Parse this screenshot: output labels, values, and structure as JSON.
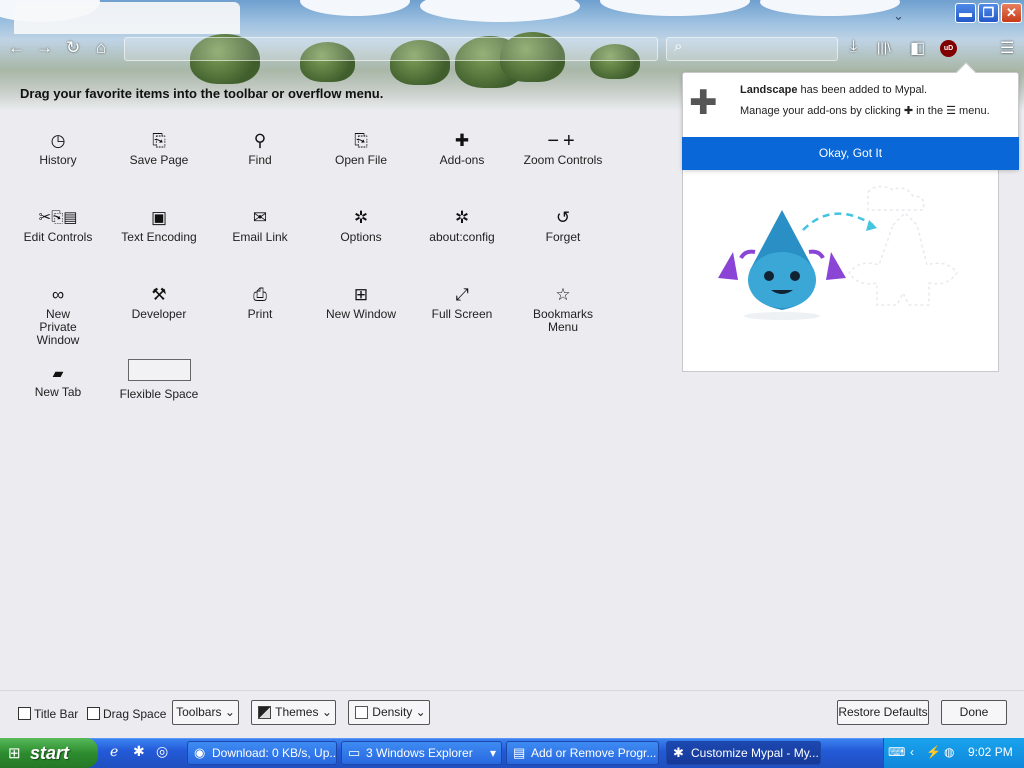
{
  "colors": {
    "accent": "#0a67d8",
    "taskbar": "#245ad8",
    "start": "#2d8c2f"
  },
  "window_buttons": {
    "minimize": "▬",
    "restore": "❐",
    "close": "✕"
  },
  "nav": {
    "back": "←",
    "forward": "→",
    "reload": "↻",
    "home": "⌂",
    "search_glyph": "⌕",
    "downloads": "⤓",
    "library": "|||\\",
    "sidebar": "◧",
    "ublock": "uD",
    "menu": "☰",
    "tab_list": "⌄"
  },
  "drag_hint": "Drag your favorite items into the toolbar or overflow menu.",
  "palette": [
    {
      "name": "history",
      "icon": "◷",
      "label": "History"
    },
    {
      "name": "save-page",
      "icon": "⎘",
      "label": "Save Page"
    },
    {
      "name": "find",
      "icon": "⚲",
      "label": "Find"
    },
    {
      "name": "open-file",
      "icon": "⎘",
      "label": "Open File"
    },
    {
      "name": "add-ons",
      "icon": "✚",
      "label": "Add-ons"
    },
    {
      "name": "zoom-controls",
      "icon": "−+",
      "label": "Zoom Controls"
    },
    {
      "name": "edit-controls",
      "icon": "✂⎘▤",
      "label": "Edit Controls"
    },
    {
      "name": "text-encoding",
      "icon": "▣",
      "label": "Text Encoding"
    },
    {
      "name": "email-link",
      "icon": "✉",
      "label": "Email Link"
    },
    {
      "name": "options",
      "icon": "✲",
      "label": "Options"
    },
    {
      "name": "about-config",
      "icon": "✲",
      "label": "about:config"
    },
    {
      "name": "forget",
      "icon": "↺",
      "label": "Forget"
    },
    {
      "name": "new-private-window",
      "icon": "∞",
      "label": "New Private Window"
    },
    {
      "name": "developer",
      "icon": "⚒",
      "label": "Developer"
    },
    {
      "name": "print",
      "icon": "⎙",
      "label": "Print"
    },
    {
      "name": "new-window",
      "icon": "⊞",
      "label": "New Window"
    },
    {
      "name": "full-screen",
      "icon": "⤢",
      "label": "Full Screen"
    },
    {
      "name": "bookmarks-menu",
      "icon": "☆",
      "label": "Bookmarks Menu"
    },
    {
      "name": "new-tab",
      "icon": "▰",
      "label": "New Tab"
    },
    {
      "name": "flexible-space",
      "icon": "",
      "label": "Flexible Space"
    }
  ],
  "doorhanger": {
    "theme_name": "Landscape",
    "line1_rest": " has been added to Mypal.",
    "line2_a": "Manage your add-ons by clicking",
    "puzzle_small": "✚",
    "line2_b": " in the ",
    "menu_glyph": "☰",
    "line2_c": " menu.",
    "button": "Okay, Got It",
    "puzzle_big": "✚"
  },
  "footer": {
    "title_bar": "Title Bar",
    "drag_space": "Drag Space",
    "toolbars": "Toolbars",
    "themes": "Themes",
    "density": "Density",
    "restore_defaults": "Restore Defaults",
    "done": "Done",
    "caret": "⌄"
  },
  "taskbar": {
    "start": "start",
    "start_flag": "⊞",
    "quicklaunch": [
      "ℯ",
      "✱",
      "◎"
    ],
    "tasks": [
      {
        "icon": "◉",
        "label": "Download: 0 KB/s, Up..."
      },
      {
        "icon": "▭",
        "label": "3 Windows Explorer"
      },
      {
        "icon": "▤",
        "label": "Add or Remove Progr..."
      },
      {
        "icon": "✱",
        "label": "Customize Mypal - My..."
      }
    ],
    "group_caret": "▾",
    "tray_icons": [
      "⌨",
      "‹",
      "⚡",
      "◍"
    ],
    "clock": "9:02 PM"
  }
}
